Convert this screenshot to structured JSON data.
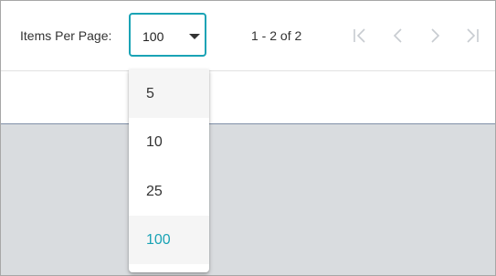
{
  "paginator": {
    "items_per_page_label": "Items Per Page:",
    "page_size_value": "100",
    "range_label": "1 - 2 of 2",
    "nav_icons": [
      "first-page-icon",
      "previous-page-icon",
      "next-page-icon",
      "last-page-icon"
    ]
  },
  "dropdown": {
    "options": [
      {
        "label": "5",
        "state": "hover"
      },
      {
        "label": "10",
        "state": "normal"
      },
      {
        "label": "25",
        "state": "normal"
      },
      {
        "label": "100",
        "state": "selected"
      }
    ]
  },
  "colors": {
    "accent": "#1aa3b5",
    "disabled_icon": "#c7cbd0",
    "empty_area": "#d9dcdf",
    "option_highlight": "#f5f5f5"
  }
}
